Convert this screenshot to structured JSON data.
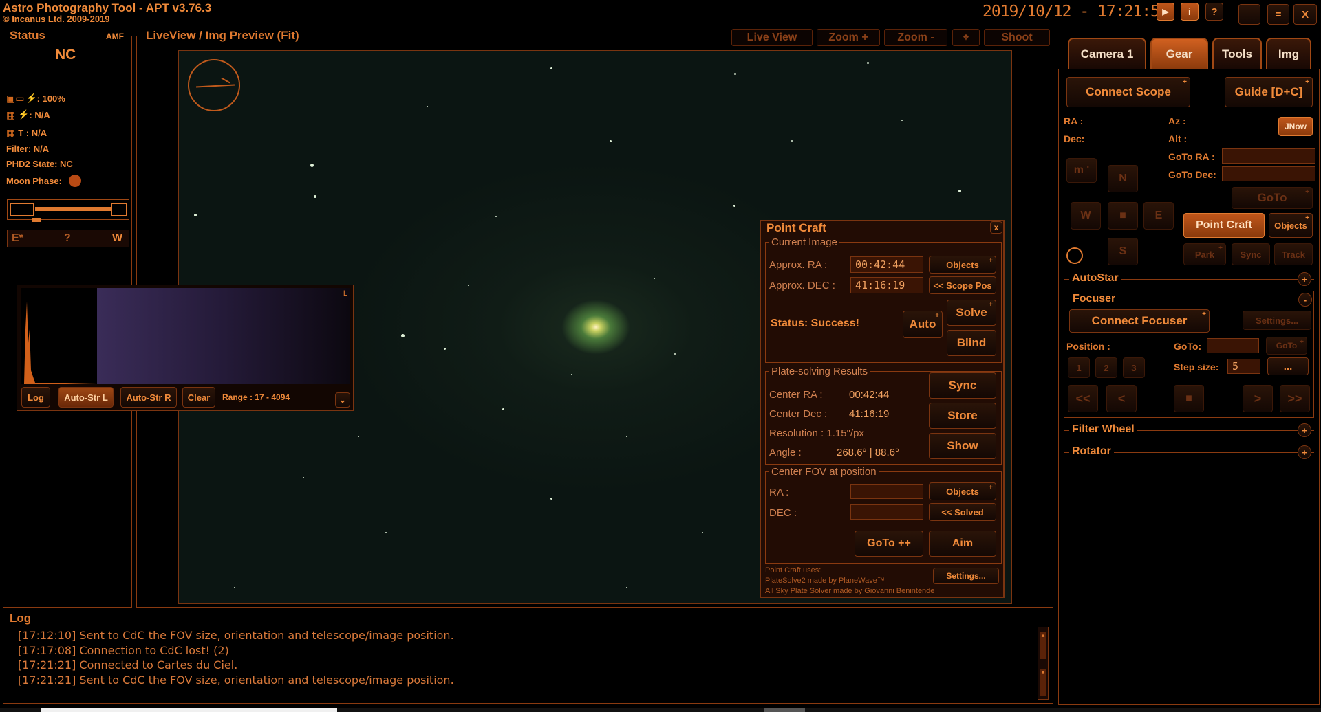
{
  "app": {
    "title": "Astro Photography Tool  -  APT v3.76.3",
    "copyright": "© Incanus Ltd. 2009-2019",
    "datetime": "2019/10/12 - 17:21:50",
    "win_min": "_",
    "win_max": "=",
    "win_close": "X"
  },
  "status": {
    "legend": "Status",
    "amf": "AMF",
    "state": "NC",
    "battery": ": 100%",
    "camera_power": ": N/A",
    "camera_temp": "T : N/A",
    "filter": "Filter: N/A",
    "phd2": "PHD2 State: NC",
    "moon_phase": "Moon Phase:",
    "meridian_east": "E*",
    "meridian_mid": "?",
    "meridian_west": "W"
  },
  "liveview": {
    "legend": "LiveView / Img Preview (Fit)",
    "tools": [
      "Live View",
      "Zoom +",
      "Zoom -",
      "Shoot"
    ]
  },
  "histogram": {
    "channel": "L",
    "log": "Log",
    "auto_l": "Auto-Str L",
    "auto_r": "Auto-Str R",
    "clear": "Clear",
    "range": "Range : 17 - 4094"
  },
  "pointcraft": {
    "title": "Point Craft",
    "close": "x",
    "current_image": "Current Image",
    "approx_ra_label": "Approx. RA :",
    "approx_ra": "00:42:44",
    "approx_dec_label": "Approx. DEC :",
    "approx_dec": "41:16:19",
    "objects": "Objects",
    "scope_pos": "<< Scope Pos",
    "status": "Status: Success!",
    "auto": "Auto",
    "solve": "Solve",
    "blind": "Blind",
    "results": "Plate-solving Results",
    "center_ra_label": "Center RA :",
    "center_ra": "00:42:44",
    "center_dec_label": "Center Dec :",
    "center_dec": "41:16:19",
    "resolution": "Resolution : 1.15\"/px",
    "angle_label": "Angle :",
    "angle": "268.6° | 88.6°",
    "sync": "Sync",
    "store": "Store",
    "show": "Show",
    "center_fov": "Center FOV at position",
    "ra_label": "RA :",
    "dec_label": "DEC :",
    "objects2": "Objects",
    "solved": "<< Solved",
    "goto": "GoTo ++",
    "aim": "Aim",
    "uses": "Point Craft uses:",
    "uses1": "PlateSolve2 made by PlaneWave™",
    "uses2": "All Sky Plate Solver made by Giovanni Benintende",
    "settings": "Settings..."
  },
  "tabs": [
    "Camera 1",
    "Gear",
    "Tools",
    "Img"
  ],
  "gear": {
    "connect_scope": "Connect Scope",
    "guide": "Guide [D+C]",
    "ra": "RA :",
    "dec": "Dec:",
    "az": "Az :",
    "alt": "Alt :",
    "jnow": "JNow",
    "goto_ra": "GoTo RA :",
    "goto_dec": "GoTo Dec:",
    "goto": "GoTo",
    "m": "m '",
    "n": "N",
    "w": "W",
    "e": "E",
    "s": "S",
    "stop": "■",
    "point_craft": "Point Craft",
    "objects": "Objects",
    "park": "Park",
    "sync": "Sync",
    "track": "Track",
    "autostar": "AutoStar",
    "focuser": "Focuser",
    "connect_focuser": "Connect Focuser",
    "focuser_settings": "Settings...",
    "position": "Position :",
    "goto_label": "GoTo:",
    "goto_btn": "GoTo",
    "presets": [
      "1",
      "2",
      "3"
    ],
    "step_size_label": "Step size:",
    "step_size": "5",
    "more": "...",
    "moves": [
      "<<",
      "<",
      "■",
      ">",
      ">>"
    ],
    "filter_wheel": "Filter Wheel",
    "rotator": "Rotator"
  },
  "log": {
    "legend": "Log",
    "lines": [
      "[17:12:10] Sent to CdC the FOV size, orientation and telescope/image position.",
      "[17:17:08] Connection to CdC lost! (2)",
      "[17:21:21] Connected to Cartes du Ciel.",
      "[17:21:21] Sent to CdC the FOV size, orientation and telescope/image position."
    ]
  }
}
